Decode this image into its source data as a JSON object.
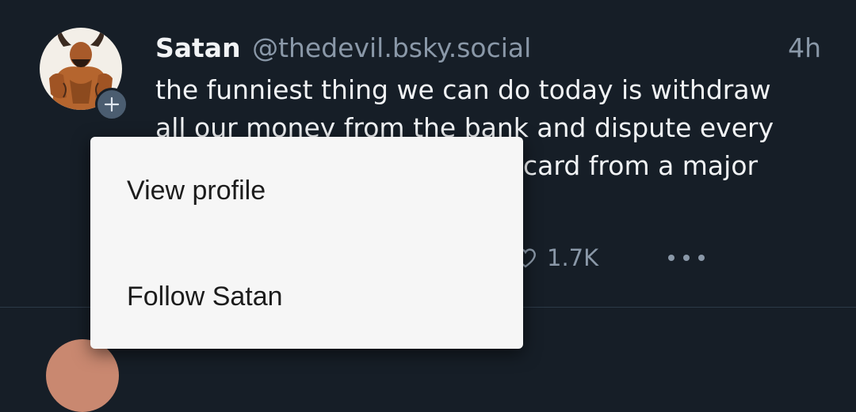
{
  "post": {
    "author_name": "Satan",
    "author_handle": "@thedevil.bsky.social",
    "time": "4h",
    "text_lines": [
      "the funniest thing we can do today is withdraw",
      "all our money from the bank and dispute every",
      "card from a major"
    ],
    "like_count": "1.7K"
  },
  "next_post": {
    "author_name": "",
    "author_handle": "",
    "time": ""
  },
  "context_menu": {
    "items": [
      {
        "label": "View profile"
      },
      {
        "label": "Follow Satan"
      }
    ]
  },
  "icons": {
    "follow_badge": "plus-icon",
    "like": "heart-icon",
    "more": "more-options-icon"
  },
  "colors": {
    "background": "#161e27",
    "text_primary": "#f1f3f5",
    "text_secondary": "#8a98a8",
    "menu_background": "#f6f6f6",
    "divider": "#2c3947"
  }
}
